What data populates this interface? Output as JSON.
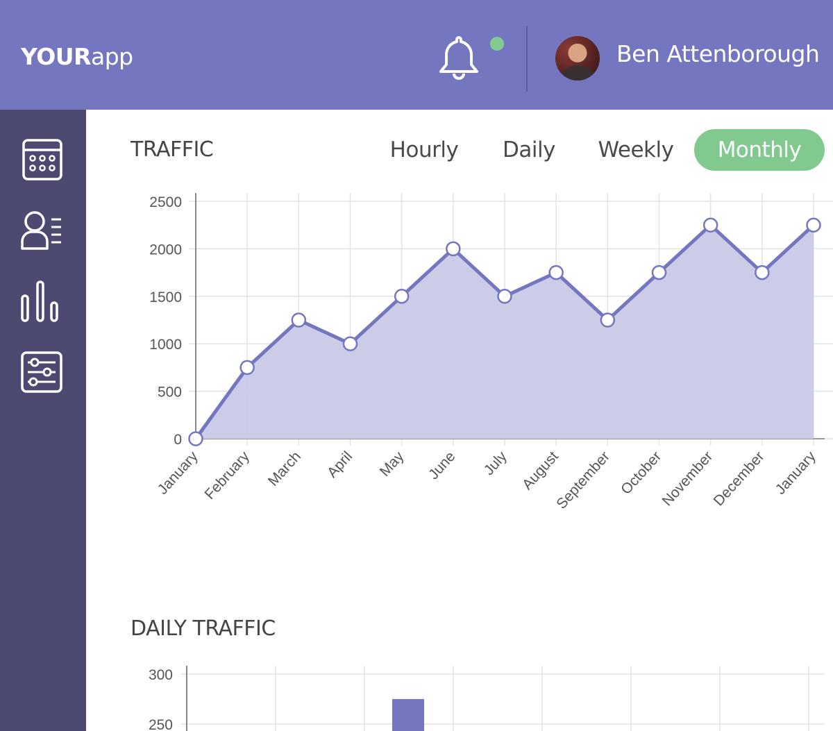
{
  "header": {
    "logo_bold": "YOUR",
    "logo_light": "app",
    "user_name": "Ben Attenborough",
    "icons": [
      "bell-icon",
      "notification-dot",
      "avatar"
    ]
  },
  "sidebar": {
    "items": [
      {
        "icon": "calendar-icon"
      },
      {
        "icon": "members-icon"
      },
      {
        "icon": "bar-chart-icon"
      },
      {
        "icon": "settings-sliders-icon"
      }
    ]
  },
  "traffic": {
    "title": "TRAFFIC",
    "tabs": [
      "Hourly",
      "Daily",
      "Weekly",
      "Monthly"
    ],
    "active_tab": "Monthly"
  },
  "daily_traffic": {
    "title": "DAILY TRAFFIC"
  },
  "colors": {
    "header": "#7476bf",
    "sidebar": "#4d4a72",
    "accent": "#81c98f",
    "line": "#7476bf",
    "fill": "#c8c9e6"
  },
  "chart_data": [
    {
      "type": "area",
      "x": [
        "January",
        "February",
        "March",
        "April",
        "May",
        "June",
        "July",
        "August",
        "September",
        "October",
        "November",
        "December",
        "January"
      ],
      "values": [
        0,
        750,
        1250,
        1000,
        1500,
        2000,
        1500,
        1750,
        1250,
        1750,
        2250,
        1750,
        2250
      ],
      "yticks": [
        0,
        500,
        1000,
        1500,
        2000,
        2500
      ],
      "ylim": [
        0,
        2500
      ],
      "grid": true
    },
    {
      "type": "bar",
      "yticks": [
        250,
        300
      ],
      "visible_bar_value": 275,
      "visible_bar_index": 2,
      "grid": true
    }
  ]
}
